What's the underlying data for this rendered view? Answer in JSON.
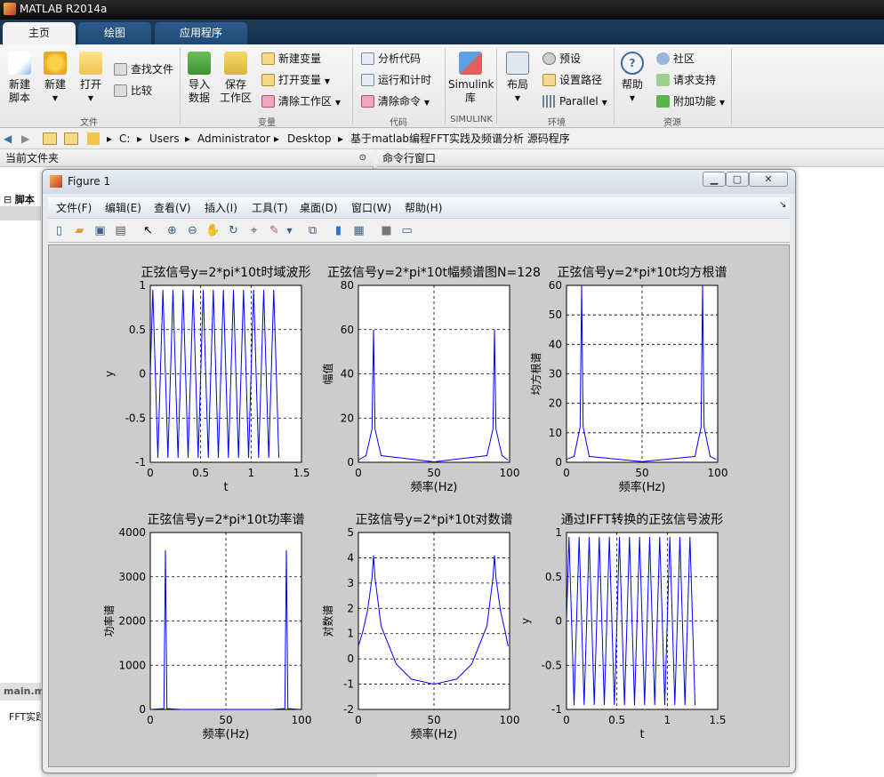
{
  "app": {
    "title": "MATLAB R2014a"
  },
  "tabs": [
    {
      "label": "主页"
    },
    {
      "label": "绘图"
    },
    {
      "label": "应用程序"
    }
  ],
  "ribbon": {
    "new_script": [
      "新建",
      "脚本"
    ],
    "new": "新建",
    "open": "打开",
    "find_files": "查找文件",
    "compare": "比较",
    "group_file": "文件",
    "import": [
      "导入",
      "数据"
    ],
    "save_ws": [
      "保存",
      "工作区"
    ],
    "new_var": "新建变量",
    "open_var": "打开变量",
    "clear_ws": "清除工作区",
    "group_var": "变量",
    "analyze": "分析代码",
    "run_time": "运行和计时",
    "clear_cmd": "清除命令",
    "group_code": "代码",
    "simulink": [
      "Simulink",
      "库"
    ],
    "group_sim": "SIMULINK",
    "layout": "布局",
    "preferences": "预设",
    "set_path": "设置路径",
    "parallel": "Parallel",
    "group_env": "环境",
    "help": "帮助",
    "community": "社区",
    "request_support": "请求支持",
    "addons": "附加功能",
    "group_res": "资源"
  },
  "path": [
    "C:",
    "Users",
    "Administrator",
    "Desktop",
    "基于matlab编程FFT实践及频谱分析 源码程序"
  ],
  "panels": {
    "current_folder": "当前文件夹",
    "command_window": "命令行窗口",
    "script_label": "脚本",
    "editor_tab": "main.m",
    "file_desc": "FFT实践"
  },
  "figure": {
    "title": "Figure 1",
    "menu": [
      "文件(F)",
      "编辑(E)",
      "查看(V)",
      "插入(I)",
      "工具(T)",
      "桌面(D)",
      "窗口(W)",
      "帮助(H)"
    ]
  },
  "colors": {
    "line": "#0000ff",
    "canvas": "#cccccc",
    "accent": "#1f4a75"
  },
  "chart_data": [
    {
      "type": "line",
      "title": "正弦信号y=2*pi*10t时域波形",
      "xlabel": "t",
      "ylabel": "y",
      "xlim": [
        0,
        1.5
      ],
      "ylim": [
        -1,
        1
      ],
      "xticks": [
        "0",
        "0.5",
        "1",
        "1.5"
      ],
      "yticks": [
        "-1",
        "-0.5",
        "0",
        "0.5",
        "1"
      ],
      "grid": true,
      "x": [
        0,
        0.01,
        0.02,
        0.03,
        0.04,
        0.05,
        0.06,
        0.07,
        0.08,
        0.09,
        0.1
      ],
      "y": [
        0,
        0.95,
        0.95,
        -0.95,
        -0.95,
        0,
        0.95,
        0.95,
        -0.95,
        -0.95,
        0
      ],
      "signal": {
        "freq": 10,
        "amp": 0.95,
        "tmax": 1.27
      }
    },
    {
      "type": "line",
      "title": "正弦信号y=2*pi*10t幅频谱图N=128",
      "xlabel": "频率(Hz)",
      "ylabel": "幅值",
      "xlim": [
        0,
        100
      ],
      "ylim": [
        0,
        80
      ],
      "xticks": [
        "0",
        "50",
        "100"
      ],
      "yticks": [
        "0",
        "20",
        "40",
        "60",
        "80"
      ],
      "grid": true,
      "x": [
        0,
        5,
        9,
        10,
        11,
        15,
        50,
        85,
        89,
        90,
        91,
        95,
        99
      ],
      "y": [
        1,
        3,
        15,
        60,
        15,
        3,
        0.2,
        3,
        15,
        60,
        15,
        3,
        1
      ]
    },
    {
      "type": "line",
      "title": "正弦信号y=2*pi*10t均方根谱",
      "xlabel": "频率(Hz)",
      "ylabel": "均方根谱",
      "xlim": [
        0,
        100
      ],
      "ylim": [
        0,
        60
      ],
      "xticks": [
        "0",
        "50",
        "100"
      ],
      "yticks": [
        "0",
        "10",
        "20",
        "30",
        "40",
        "50",
        "60"
      ],
      "grid": true,
      "x": [
        0,
        5,
        9,
        10,
        11,
        15,
        50,
        85,
        89,
        90,
        91,
        95,
        99
      ],
      "y": [
        1,
        2,
        12,
        60,
        12,
        2,
        0.2,
        2,
        12,
        60,
        12,
        2,
        1
      ]
    },
    {
      "type": "line",
      "title": "正弦信号y=2*pi*10t功率谱",
      "xlabel": "频率(Hz)",
      "ylabel": "功率谱",
      "xlim": [
        0,
        100
      ],
      "ylim": [
        0,
        4000
      ],
      "xticks": [
        "0",
        "50",
        "100"
      ],
      "yticks": [
        "0",
        "1000",
        "2000",
        "3000",
        "4000"
      ],
      "grid": true,
      "x": [
        0,
        9,
        10,
        11,
        20,
        50,
        80,
        89,
        90,
        91,
        99
      ],
      "y": [
        0,
        20,
        3600,
        20,
        0,
        0,
        0,
        20,
        3600,
        20,
        0
      ]
    },
    {
      "type": "line",
      "title": "正弦信号y=2*pi*10t对数谱",
      "xlabel": "频率(Hz)",
      "ylabel": "对数谱",
      "xlim": [
        0,
        100
      ],
      "ylim": [
        -2,
        5
      ],
      "xticks": [
        "0",
        "50",
        "100"
      ],
      "yticks": [
        "-2",
        "-1",
        "0",
        "1",
        "2",
        "3",
        "4",
        "5"
      ],
      "grid": true,
      "x": [
        0,
        3,
        6,
        9,
        10,
        11,
        15,
        25,
        35,
        50,
        65,
        75,
        85,
        89,
        90,
        91,
        94,
        97,
        99
      ],
      "y": [
        0.5,
        1.1,
        1.9,
        3.2,
        4.1,
        3.2,
        1.3,
        -0.2,
        -0.8,
        -1,
        -0.8,
        -0.2,
        1.3,
        3.2,
        4.1,
        3.2,
        1.9,
        1.1,
        0.5
      ]
    },
    {
      "type": "line",
      "title": "通过IFFT转换的正弦信号波形",
      "xlabel": "t",
      "ylabel": "y",
      "xlim": [
        0,
        1.5
      ],
      "ylim": [
        -1,
        1
      ],
      "xticks": [
        "0",
        "0.5",
        "1",
        "1.5"
      ],
      "yticks": [
        "-1",
        "-0.5",
        "0",
        "0.5",
        "1"
      ],
      "grid": true,
      "x": [
        0,
        0.01,
        0.02,
        0.03,
        0.04,
        0.05,
        0.06,
        0.07,
        0.08,
        0.09,
        0.1
      ],
      "y": [
        0,
        0.95,
        0.95,
        -0.95,
        -0.95,
        0,
        0.95,
        0.95,
        -0.95,
        -0.95,
        0
      ],
      "signal": {
        "freq": 10,
        "amp": 0.95,
        "tmax": 1.27
      }
    }
  ]
}
